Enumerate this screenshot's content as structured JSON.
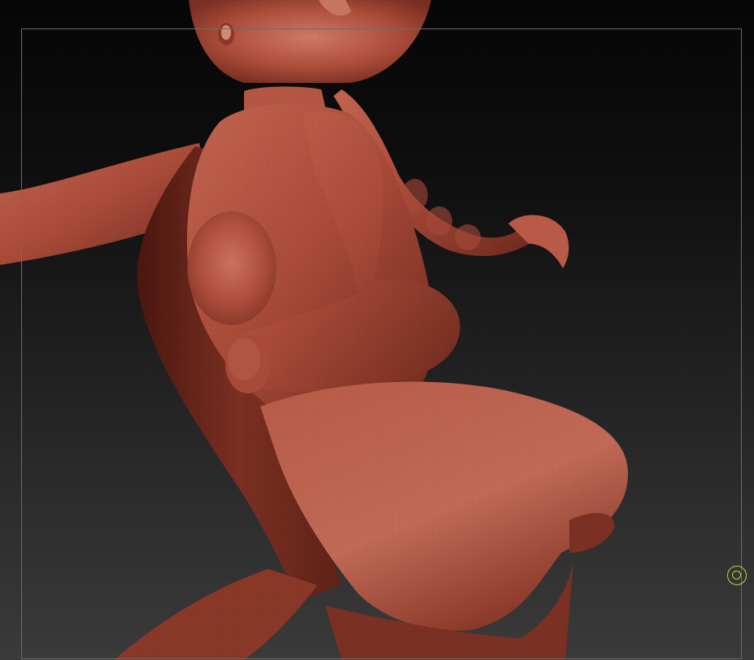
{
  "viewport": {
    "background_top": "#060606",
    "background_bottom": "#3a3a3a",
    "frame_color": "#6a6a6a"
  },
  "model": {
    "material_base": "#a84a38",
    "material_light": "#c9705c",
    "material_dark": "#5a1f16",
    "material_shadow": "#3a120c"
  },
  "cursor": {
    "icon": "brush-cursor-icon",
    "color": "#c8d23a"
  }
}
